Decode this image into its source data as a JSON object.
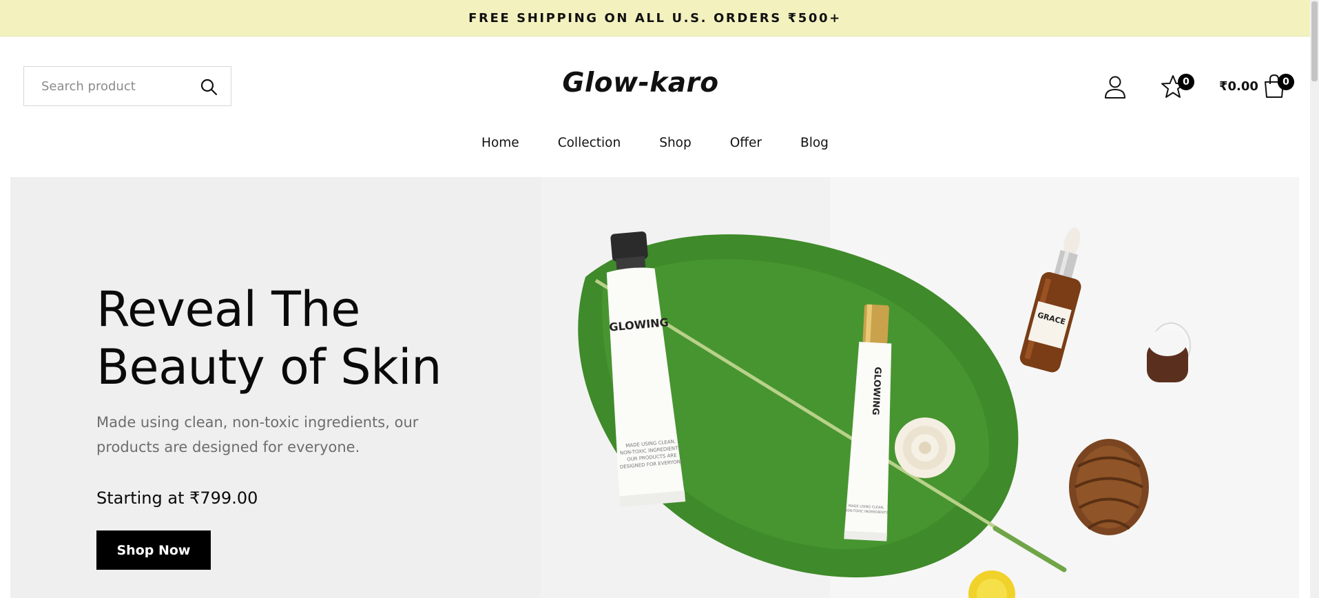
{
  "announcement": "FREE SHIPPING ON ALL U.S. ORDERS ₹500+",
  "search": {
    "placeholder": "Search product",
    "icon": "search-icon"
  },
  "brand": {
    "logo_text": "Glow-karo"
  },
  "header": {
    "account_icon": "user-icon",
    "wishlist_icon": "star-icon",
    "wishlist_count": "0",
    "cart_icon": "shopping-bag-icon",
    "cart_total": "₹0.00",
    "cart_count": "0"
  },
  "nav": {
    "items": [
      "Home",
      "Collection",
      "Shop",
      "Offer",
      "Blog"
    ]
  },
  "hero": {
    "title_line1": "Reveal The",
    "title_line2": "Beauty of Skin",
    "subtitle": "Made using clean, non-toxic ingredients, our products are designed for everyone.",
    "price": "Starting at ₹799.00",
    "cta": "Shop Now",
    "image": {
      "tube_label": "GLOWING",
      "tube_small_text": [
        "MADE USING CLEAN,",
        "NON-TOXIC INGREDIENTS,",
        "OUR PRODUCTS ARE",
        "DESIGNED FOR EVERYONE."
      ],
      "small_tube_label": "GLOWING",
      "small_tube_text": [
        "MADE USING CLEAN,",
        "NON-TOXIC INGREDIENTS"
      ],
      "bottle_label": "GRACE"
    }
  },
  "colors": {
    "announcement_bg": "#f3f2bf",
    "hero_bg": "#efefef",
    "button_bg": "#000000",
    "leaf_green": "#3f8a2a"
  }
}
